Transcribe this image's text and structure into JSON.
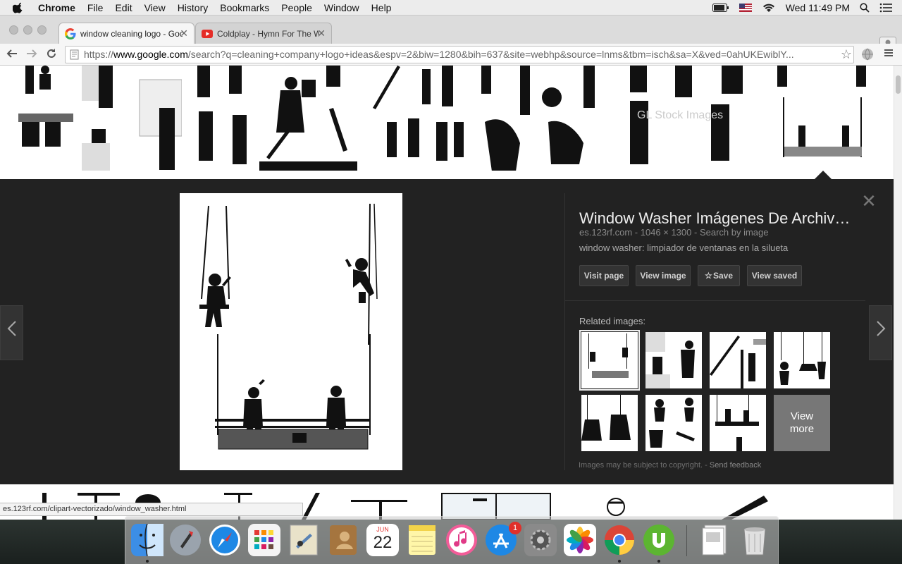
{
  "menubar": {
    "app_name": "Chrome",
    "items": [
      "File",
      "Edit",
      "View",
      "History",
      "Bookmarks",
      "People",
      "Window",
      "Help"
    ],
    "clock": "Wed 11:49 PM"
  },
  "tabs": [
    {
      "title": "window cleaning logo - Goo",
      "favicon": "google-g-icon",
      "active": true
    },
    {
      "title": "Coldplay - Hymn For The W",
      "favicon": "youtube-icon",
      "active": false
    }
  ],
  "toolbar": {
    "url_scheme": "https://",
    "url_host": "www.google.com",
    "url_rest": "/search?q=cleaning+company+logo+ideas&espv=2&biw=1280&bih=637&site=webhp&source=lnms&tbm=isch&sa=X&ved=0ahUKEwiblY..."
  },
  "panel": {
    "title": "Window Washer Imágenes De Archiv…",
    "source": "es.123rf.com",
    "dimensions": "1046 × 1300",
    "search_by_image": "Search by image",
    "meta_sep": " - ",
    "description": "window washer: limpiador de ventanas en la silueta",
    "buttons": {
      "visit": "Visit page",
      "view": "View image",
      "save": "Save",
      "saved": "View saved"
    },
    "related_label": "Related images:",
    "view_more": "View\nmore",
    "copyright": "Images may be subject to copyright.",
    "copyright_sep": " - ",
    "feedback": "Send feedback"
  },
  "status_bar": "es.123rf.com/clipart-vectorizado/window_washer.html",
  "dock": {
    "calendar_month": "JUN",
    "calendar_day": "22",
    "appstore_badge": "1",
    "icons": [
      "finder-icon",
      "launchpad-icon",
      "safari-icon",
      "apps-grid-icon",
      "mail-icon",
      "contacts-icon",
      "calendar-icon",
      "notes-icon",
      "itunes-icon",
      "app-store-icon",
      "system-preferences-icon",
      "photos-icon",
      "chrome-icon",
      "utorrent-icon",
      "pdf-document-icon",
      "trash-icon"
    ]
  },
  "colors": {
    "panel_bg": "#222222",
    "chrome_blue": "#4285f4"
  }
}
